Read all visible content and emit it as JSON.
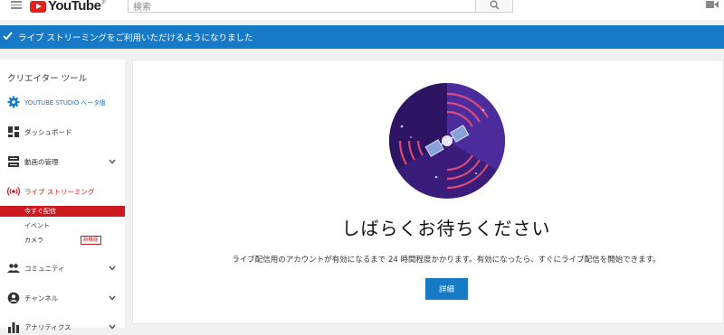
{
  "header": {
    "logo_text": "YouTube",
    "logo_sup": "JP",
    "search_placeholder": "検索"
  },
  "banner": {
    "message": "ライブ ストリーミングをご利用いただけるようになりました",
    "color": "#167ac6"
  },
  "sidebar": {
    "title": "クリエイター ツール",
    "items": [
      {
        "label": "YOUTUBE STUDIO ベータ版",
        "icon": "gear-icon",
        "color": "#167ac6"
      },
      {
        "label": "ダッシュボード",
        "icon": "dashboard-icon"
      },
      {
        "label": "動画の管理",
        "icon": "video-manager-icon",
        "expandable": true
      },
      {
        "label": "ライブ ストリーミング",
        "icon": "live-icon",
        "color": "#cc181e",
        "expandable": true
      },
      {
        "label": "コミュニティ",
        "icon": "community-icon",
        "expandable": true
      },
      {
        "label": "チャンネル",
        "icon": "channel-icon",
        "expandable": true
      },
      {
        "label": "アナリティクス",
        "icon": "analytics-icon",
        "expandable": true
      }
    ],
    "live_subitems": [
      {
        "label": "今すぐ配信",
        "active": true
      },
      {
        "label": "イベント"
      },
      {
        "label": "カメラ",
        "badge": "新機能"
      }
    ]
  },
  "main": {
    "title": "しばらくお待ちください",
    "description": "ライブ配信用のアカウントが有効になるまで 24 時間程度かかります。有効になったら、すぐにライブ配信を開始できます。",
    "button_label": "詳細"
  },
  "colors": {
    "accent": "#167ac6",
    "active": "#cc181e"
  }
}
